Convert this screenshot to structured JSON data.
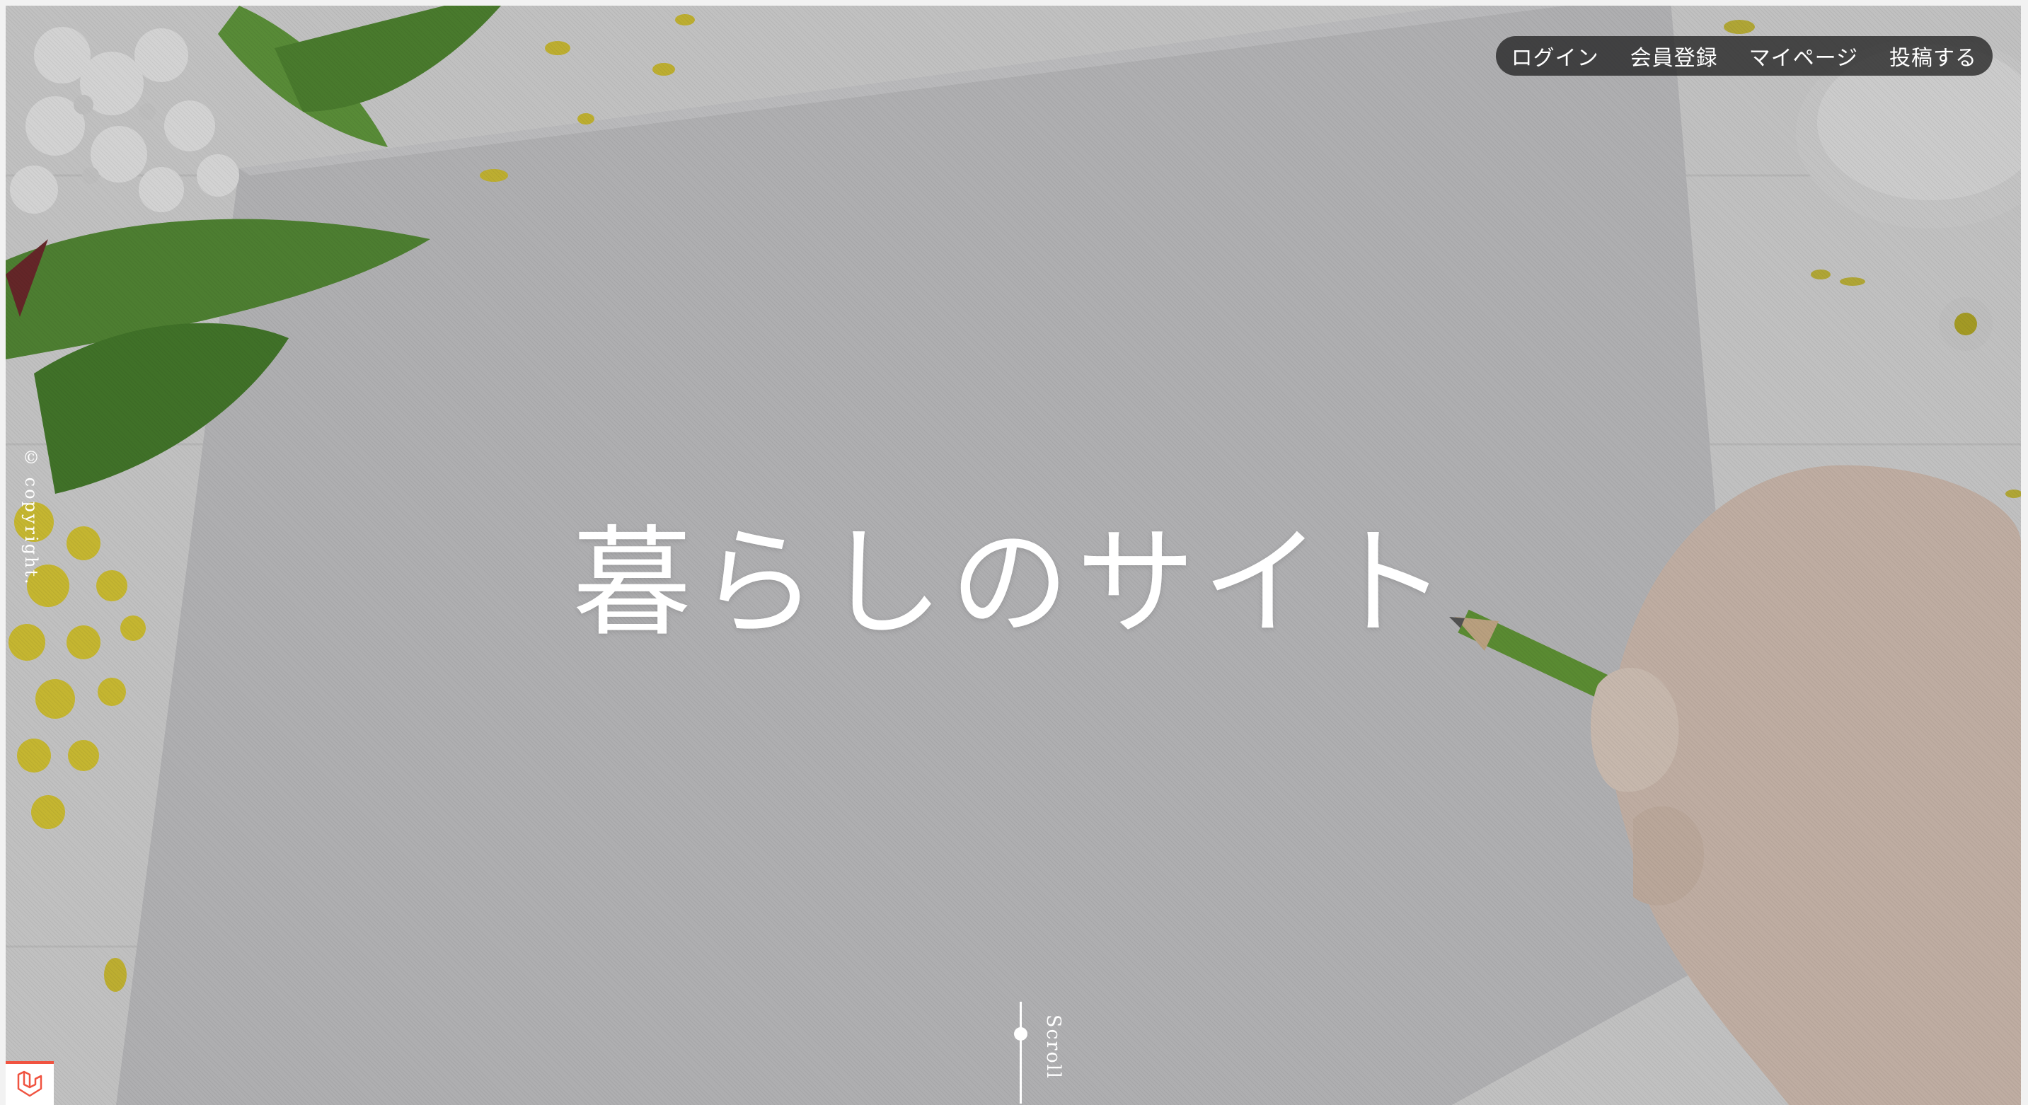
{
  "nav": {
    "items": [
      {
        "label": "ログイン"
      },
      {
        "label": "会員登録"
      },
      {
        "label": "マイページ"
      },
      {
        "label": "投稿する"
      }
    ]
  },
  "hero": {
    "title": "暮らしのサイト",
    "copyright": "© copyright.",
    "scroll_label": "Scroll"
  },
  "colors": {
    "nav_bg": "#232323",
    "text": "#ffffff",
    "accent_red": "#f05340",
    "paper": "#c9c9cb"
  },
  "icons": {
    "corner_logo": "laravel-logo-icon",
    "scroll_indicator": "scroll-indicator-icon"
  }
}
